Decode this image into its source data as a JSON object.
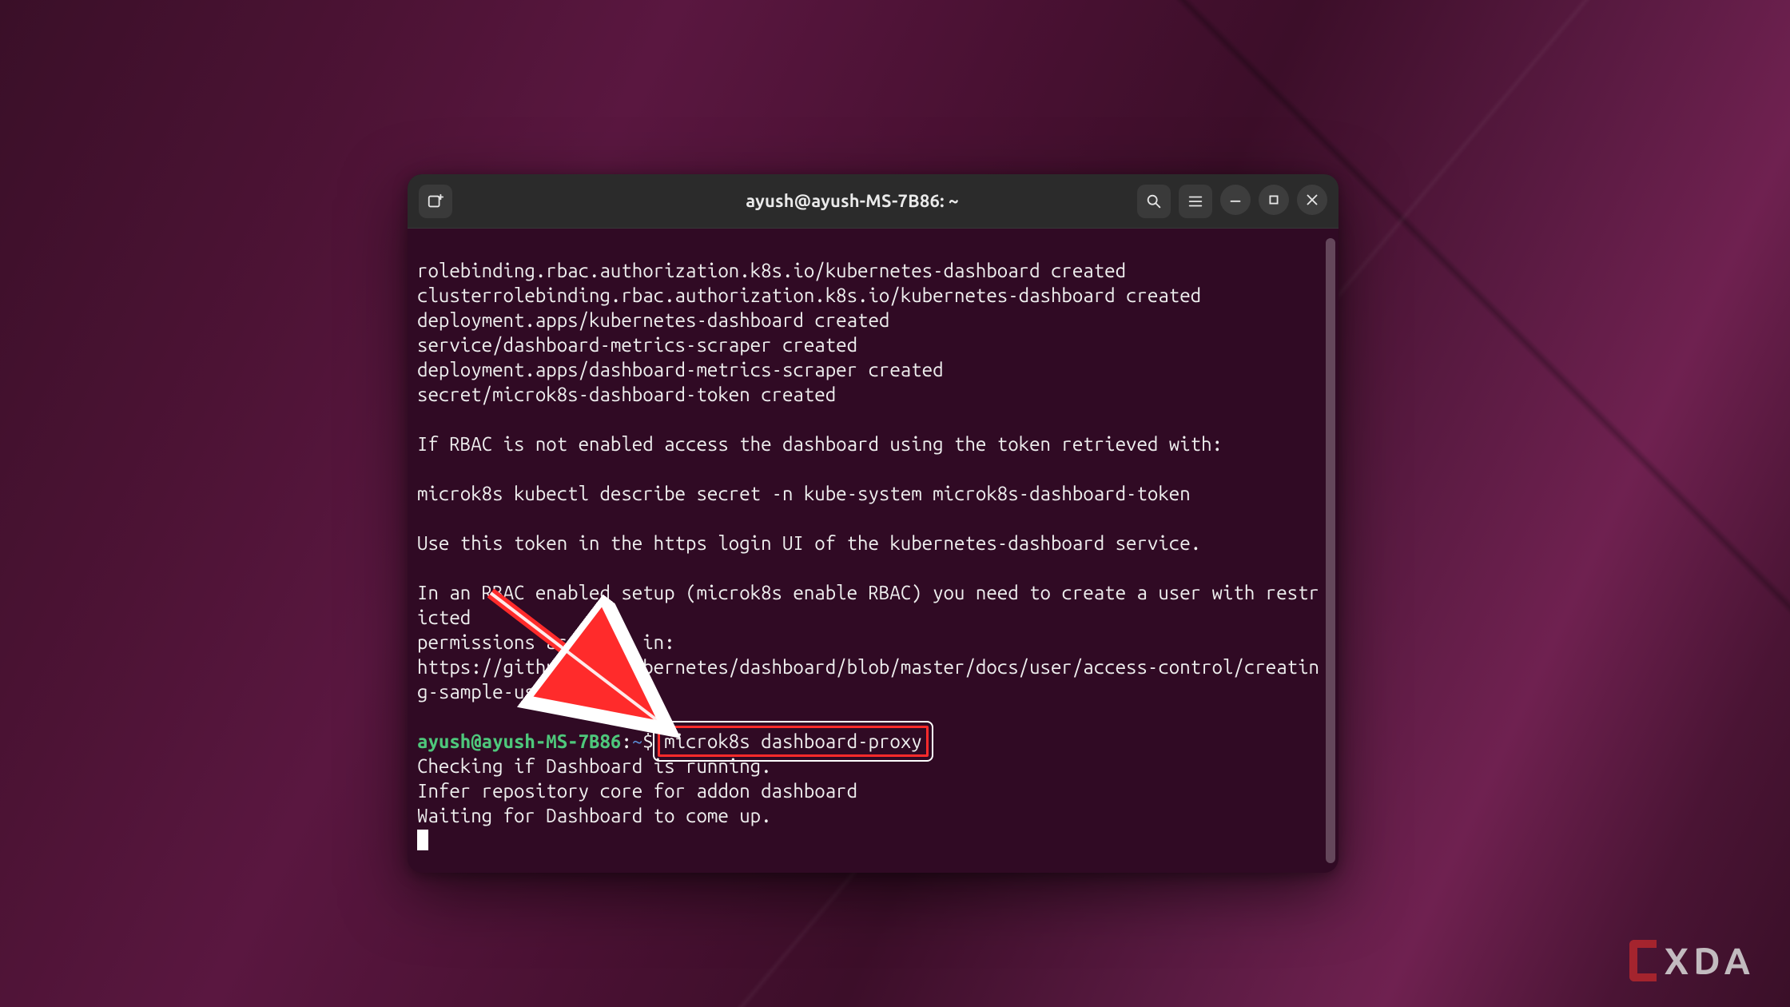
{
  "window": {
    "title": "ayush@ayush-MS-7B86: ~",
    "buttons": {
      "new_tab_icon": "new-tab",
      "search_icon": "search",
      "menu_icon": "hamburger",
      "minimize_icon": "minimize",
      "maximize_icon": "maximize",
      "close_icon": "close"
    }
  },
  "prompt": {
    "user_host": "ayush@ayush-MS-7B86",
    "separator": ":",
    "path": "~",
    "symbol": "$",
    "command": "microk8s dashboard-proxy"
  },
  "terminal_lines": {
    "l1": "rolebinding.rbac.authorization.k8s.io/kubernetes-dashboard created",
    "l2": "clusterrolebinding.rbac.authorization.k8s.io/kubernetes-dashboard created",
    "l3": "deployment.apps/kubernetes-dashboard created",
    "l4": "service/dashboard-metrics-scraper created",
    "l5": "deployment.apps/dashboard-metrics-scraper created",
    "l6": "secret/microk8s-dashboard-token created",
    "l7": "",
    "l8": "If RBAC is not enabled access the dashboard using the token retrieved with:",
    "l9": "",
    "l10": "microk8s kubectl describe secret -n kube-system microk8s-dashboard-token",
    "l11": "",
    "l12": "Use this token in the https login UI of the kubernetes-dashboard service.",
    "l13": "",
    "l14": "In an RBAC enabled setup (microk8s enable RBAC) you need to create a user with restricted",
    "l15": "permissions as shown in:",
    "l16": "https://github.com/kubernetes/dashboard/blob/master/docs/user/access-control/creating-sample-user.md",
    "l17": "",
    "l18_post1": "Checking if Dashboard is running.",
    "l18_post2": "Infer repository core for addon dashboard",
    "l18_post3": "Waiting for Dashboard to come up."
  },
  "annotation": {
    "highlighted_text": "microk8s dashboard-proxy",
    "arrow_color": "#ff2b2b"
  },
  "watermark": {
    "text": "XDA"
  }
}
